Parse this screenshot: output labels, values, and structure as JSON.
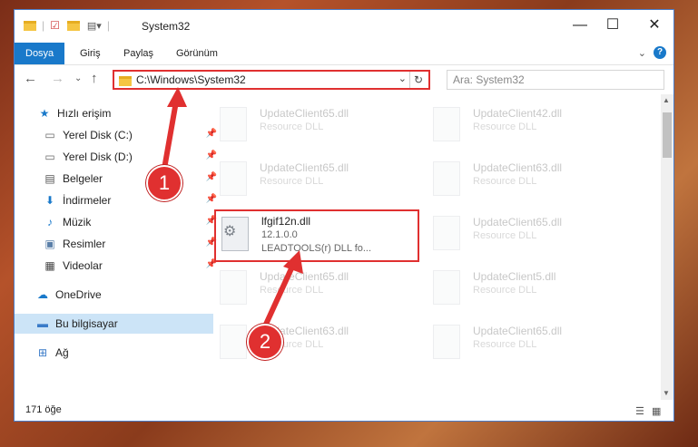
{
  "window": {
    "title": "System32"
  },
  "ribbon": {
    "tabs": [
      "Dosya",
      "Giriş",
      "Paylaş",
      "Görünüm"
    ]
  },
  "address": {
    "path": "C:\\Windows\\System32",
    "search_placeholder": "Ara: System32"
  },
  "sidebar": {
    "items": [
      {
        "label": "Hızlı erişim",
        "icon": "star-icon"
      },
      {
        "label": "Yerel Disk (C:)",
        "icon": "drive-icon",
        "pinned": true
      },
      {
        "label": "Yerel Disk (D:)",
        "icon": "drive-icon",
        "pinned": true
      },
      {
        "label": "Belgeler",
        "icon": "documents-icon",
        "pinned": true
      },
      {
        "label": "İndirmeler",
        "icon": "download-icon",
        "pinned": true
      },
      {
        "label": "Müzik",
        "icon": "music-icon",
        "pinned": true
      },
      {
        "label": "Resimler",
        "icon": "pictures-icon",
        "pinned": true
      },
      {
        "label": "Videolar",
        "icon": "videos-icon",
        "pinned": true
      },
      {
        "label": "OneDrive",
        "icon": "cloud-icon"
      },
      {
        "label": "Bu bilgisayar",
        "icon": "computer-icon",
        "selected": true
      },
      {
        "label": "Ağ",
        "icon": "network-icon"
      }
    ]
  },
  "files": {
    "left": [
      {
        "name": "UpdateClient65.dll",
        "desc": "Resource DLL"
      },
      {
        "name": "UpdateClient65.dll",
        "desc": "Resource DLL"
      },
      {
        "name": "lfgif12n.dll",
        "version": "12.1.0.0",
        "desc": "LEADTOOLS(r) DLL fo..."
      },
      {
        "name": "UpdateClient65.dll",
        "desc": "Resource DLL"
      },
      {
        "name": "UpdateClient63.dll",
        "desc": "Resource DLL"
      }
    ],
    "right": [
      {
        "name": "UpdateClient42.dll",
        "desc": "Resource DLL"
      },
      {
        "name": "UpdateClient63.dll",
        "desc": "Resource DLL"
      },
      {
        "name": "UpdateClient65.dll",
        "desc": "Resource DLL"
      },
      {
        "name": "UpdateClient5.dll",
        "desc": "Resource DLL"
      },
      {
        "name": "UpdateClient65.dll",
        "desc": "Resource DLL"
      }
    ]
  },
  "status": {
    "count": "171 öğe"
  },
  "annotations": {
    "step1": "1",
    "step2": "2"
  },
  "colors": {
    "accent": "#1979ca",
    "highlight": "#e03030"
  }
}
